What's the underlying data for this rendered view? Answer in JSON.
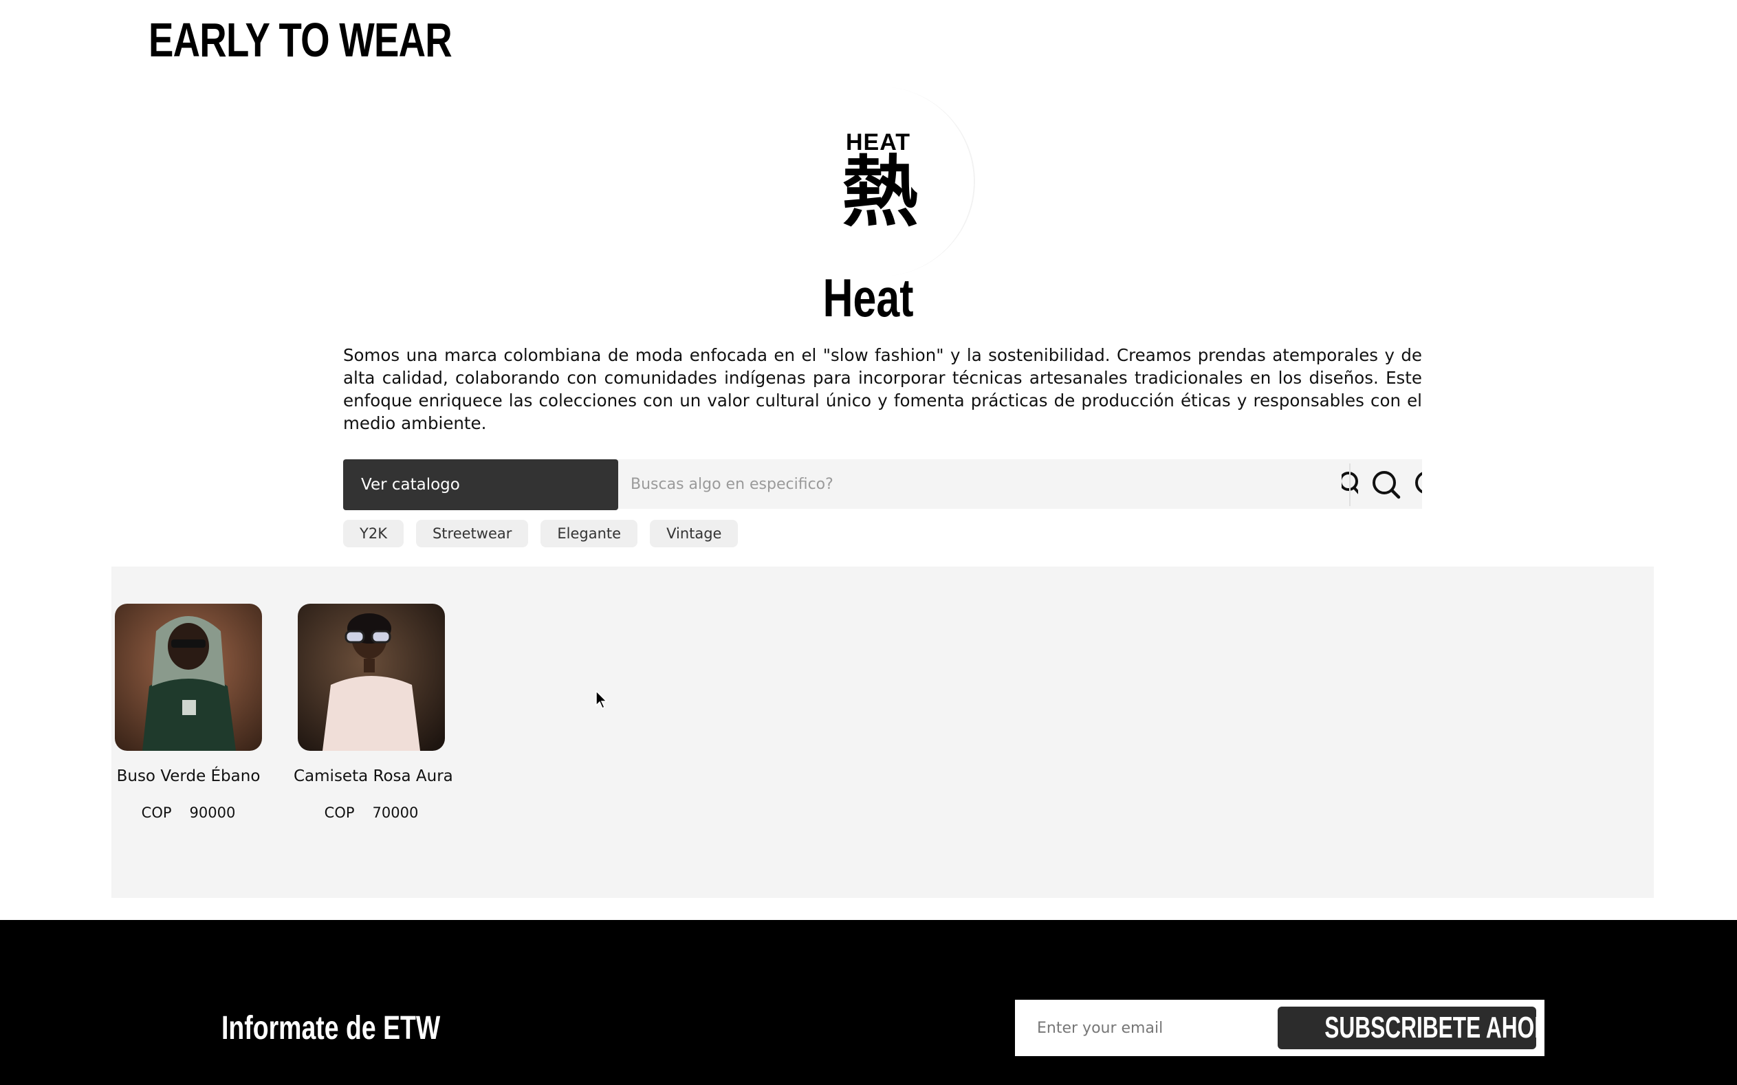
{
  "header": {
    "site_title": "EARLY TO WEAR"
  },
  "brand": {
    "logo_text": "HEAT",
    "logo_kanji": "熱",
    "name": "Heat",
    "description": "Somos una marca colombiana de moda enfocada en el \"slow fashion\" y la sostenibilidad. Creamos prendas atemporales y de alta calidad, colaborando con comunidades indígenas para incorporar técnicas artesanales tradicionales en los diseños. Este enfoque enriquece las colecciones con un valor cultural único y fomenta prácticas de producción éticas y responsables con el medio ambiente."
  },
  "search": {
    "catalog_label": "Ver catalogo",
    "placeholder": "Buscas algo en especifico?",
    "icon": "search-icon"
  },
  "tags": [
    "Y2K",
    "Streetwear",
    "Elegante",
    "Vintage"
  ],
  "products": [
    {
      "name": "Buso Verde Ébano",
      "currency": "COP",
      "price": "90000"
    },
    {
      "name": "Camiseta Rosa Aura",
      "currency": "COP",
      "price": "70000"
    }
  ],
  "footer": {
    "title": "Informate de ETW",
    "email_placeholder": "Enter your email",
    "subscribe_label": "SUBSCRIBETE AHORA"
  },
  "colors": {
    "catalog_button": "#333333",
    "products_background": "#f4f4f4",
    "footer_background": "#000000",
    "subscribe_button": "#2c2c2c"
  }
}
